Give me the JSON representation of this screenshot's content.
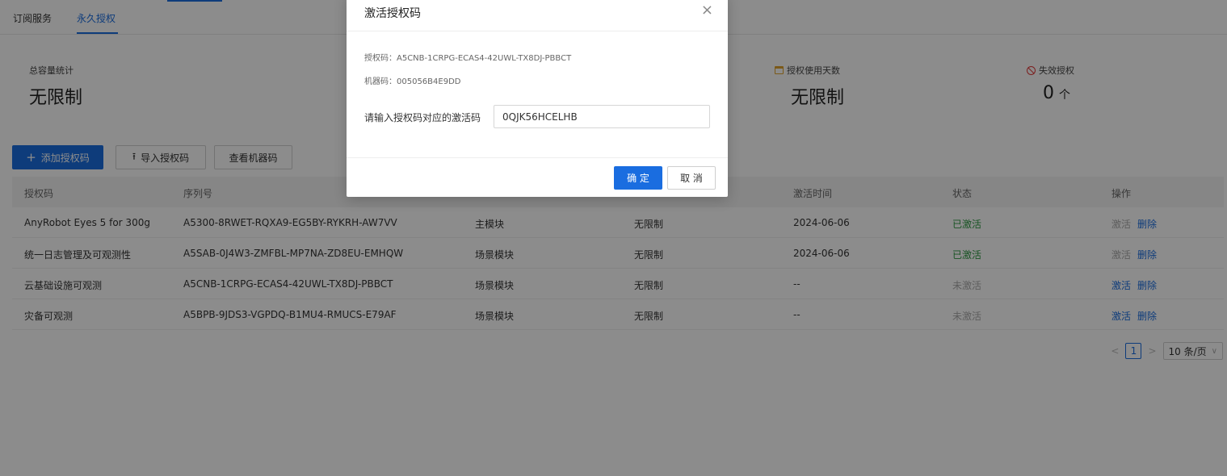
{
  "tabs": [
    {
      "label": "订阅服务"
    },
    {
      "label": "永久授权"
    }
  ],
  "stats": {
    "total_capacity": {
      "label": "总容量统计",
      "value": "无限制"
    },
    "usage_days": {
      "label": "授权使用天数",
      "value": "无限制"
    },
    "invalid": {
      "label": "失效授权",
      "value": "0",
      "unit": "个"
    }
  },
  "toolbar": {
    "add_label": "添加授权码",
    "import_label": "导入授权码",
    "view_machine_label": "查看机器码"
  },
  "table": {
    "headers": [
      "授权码",
      "序列号",
      "",
      "",
      "激活时间",
      "状态",
      "操作"
    ],
    "rows": [
      {
        "name": "AnyRobot Eyes 5 for 300g",
        "serial": "A5300-8RWET-RQXA9-EG5BY-RYKRH-AW7VV",
        "type": "主模块",
        "limit": "无限制",
        "time": "2024-06-06",
        "status": "已激活",
        "activate": "激活",
        "delete": "删除"
      },
      {
        "name": "统一日志管理及可观测性",
        "serial": "A5SAB-0J4W3-ZMFBL-MP7NA-ZD8EU-EMHQW",
        "type": "场景模块",
        "limit": "无限制",
        "time": "2024-06-06",
        "status": "已激活",
        "activate": "激活",
        "delete": "删除"
      },
      {
        "name": "云基础设施可观测",
        "serial": "A5CNB-1CRPG-ECAS4-42UWL-TX8DJ-PBBCT",
        "type": "场景模块",
        "limit": "无限制",
        "time": "--",
        "status": "未激活",
        "activate": "激活",
        "delete": "删除"
      },
      {
        "name": "灾备可观测",
        "serial": "A5BPB-9JDS3-VGPDQ-B1MU4-RMUCS-E79AF",
        "type": "场景模块",
        "limit": "无限制",
        "time": "--",
        "status": "未激活",
        "activate": "激活",
        "delete": "删除"
      }
    ]
  },
  "pagination": {
    "prev": "<",
    "page": "1",
    "next": ">",
    "page_size": "10 条/页"
  },
  "modal": {
    "title": "激活授权码",
    "close": "×",
    "auth_code": "授权码：A5CNB-1CRPG-ECAS4-42UWL-TX8DJ-PBBCT",
    "machine_code": "机器码：005056B4E9DD",
    "input_label": "请输入授权码对应的激活码",
    "input_value": "0QJK56HCELHB",
    "ok_label": "确 定",
    "cancel_label": "取 消"
  },
  "colors": {
    "accent": "#1a6de0",
    "success": "#2e9a43",
    "mask": "rgba(0,0,0,0.45)"
  },
  "icons": [
    "plus-icon",
    "upload-icon",
    "calendar-icon",
    "ban-icon",
    "close-icon",
    "chevron-down-icon"
  ]
}
